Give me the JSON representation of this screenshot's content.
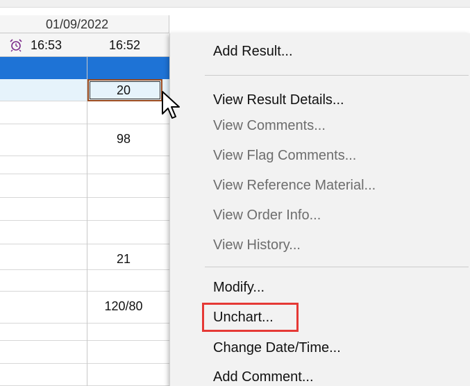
{
  "header": {
    "date": "01/09/2022",
    "times": [
      "16:53",
      "16:52"
    ]
  },
  "grid": {
    "values": [
      {
        "row": 1,
        "value": "20"
      },
      {
        "row": 3,
        "value": "98"
      },
      {
        "row": 8,
        "value": "21"
      },
      {
        "row": 10,
        "value": "120/80"
      }
    ]
  },
  "context_menu": {
    "items": [
      {
        "label": "Add Result...",
        "enabled": true
      },
      {
        "label": "View Result Details...",
        "enabled": true
      },
      {
        "label": "View Comments...",
        "enabled": false
      },
      {
        "label": "View Flag Comments...",
        "enabled": false
      },
      {
        "label": "View Reference Material...",
        "enabled": false
      },
      {
        "label": "View Order Info...",
        "enabled": false
      },
      {
        "label": "View History...",
        "enabled": false
      },
      {
        "label": "Modify...",
        "enabled": true
      },
      {
        "label": "Unchart...",
        "enabled": true,
        "highlighted": true
      },
      {
        "label": "Change Date/Time...",
        "enabled": true
      },
      {
        "label": "Add Comment...",
        "enabled": true
      }
    ]
  },
  "colors": {
    "selection_row": "#1e73d6",
    "selected_cell_bg": "#e6f3fb",
    "highlight_box": "#e53935",
    "disabled_text": "#6d6d6d"
  },
  "icons": {
    "time_flag": "alarm-clock-icon",
    "pointer": "mouse-cursor-icon"
  }
}
